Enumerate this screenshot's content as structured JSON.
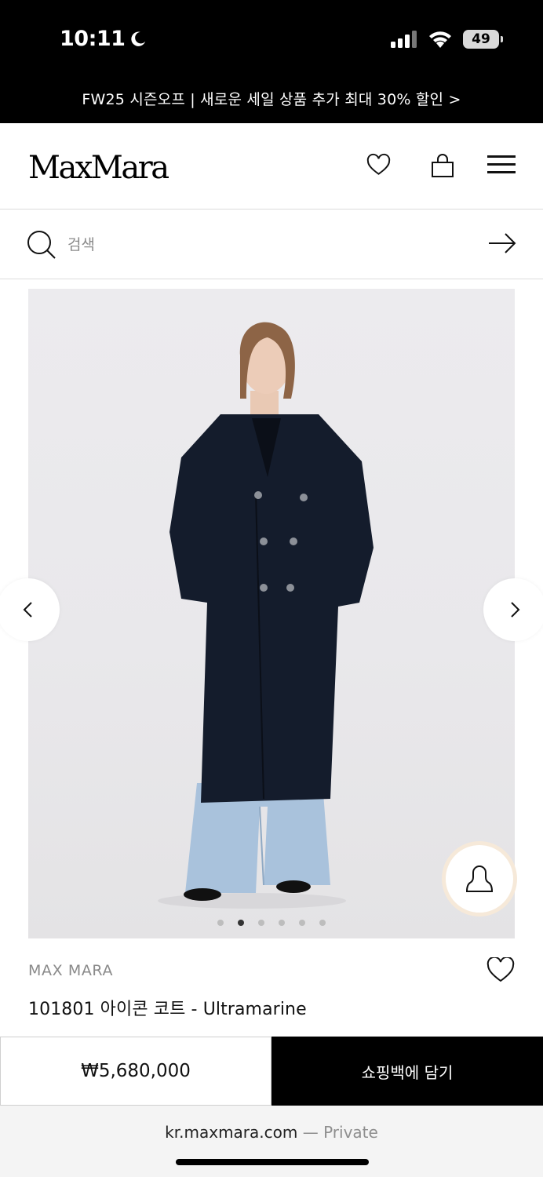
{
  "status_bar": {
    "time": "10:11",
    "battery": "49"
  },
  "promo": {
    "text": "FW25 시즌오프 | 새로운 세일 상품 추가 최대 30% 할인 >"
  },
  "header": {
    "logo": "MaxMara"
  },
  "search": {
    "placeholder": "검색"
  },
  "gallery": {
    "slide_count": 6,
    "active_index": 1
  },
  "product": {
    "brand": "MAX MARA",
    "name": "101801 아이콘 코트 - Ultramarine",
    "price": "₩5,680,000",
    "add_to_bag": "쇼핑백에 담기"
  },
  "browser": {
    "domain": "kr.maxmara.com",
    "private_label": "— Private"
  }
}
